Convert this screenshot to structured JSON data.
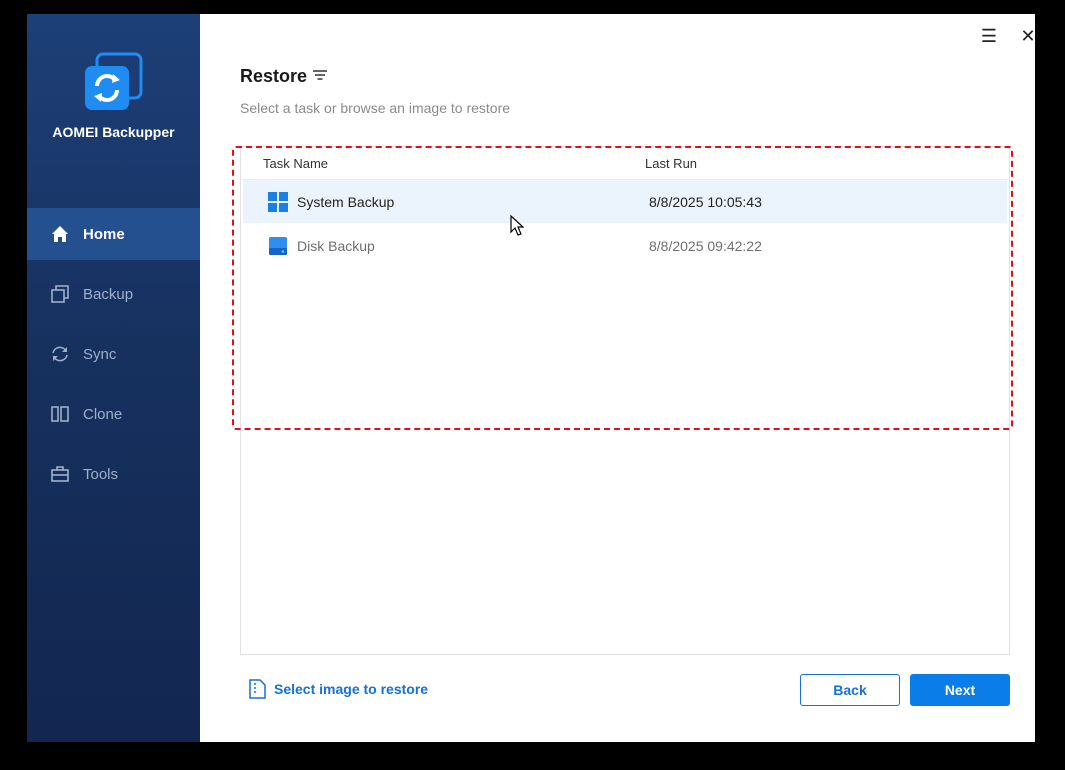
{
  "app": {
    "name": "AOMEI Backupper"
  },
  "window_controls": {
    "menu_icon": "hamburger-icon",
    "close_icon": "close-icon",
    "menu_glyph": "☰",
    "close_glyph": "✕"
  },
  "sidebar": {
    "items": [
      {
        "label": "Home",
        "icon": "home-icon",
        "active": true
      },
      {
        "label": "Backup",
        "icon": "backup-icon",
        "active": false
      },
      {
        "label": "Sync",
        "icon": "sync-icon",
        "active": false
      },
      {
        "label": "Clone",
        "icon": "clone-icon",
        "active": false
      },
      {
        "label": "Tools",
        "icon": "tools-icon",
        "active": false
      }
    ]
  },
  "page": {
    "title": "Restore",
    "subtitle": "Select a task or browse an image to restore"
  },
  "table": {
    "columns": [
      "Task Name",
      "Last Run"
    ],
    "rows": [
      {
        "name": "System Backup",
        "last_run": "8/8/2025 10:05:43",
        "icon": "windows-icon",
        "selected": true
      },
      {
        "name": "Disk Backup",
        "last_run": "8/8/2025 09:42:22",
        "icon": "disk-icon",
        "selected": false
      }
    ]
  },
  "footer": {
    "select_image_label": "Select image to restore",
    "back_label": "Back",
    "next_label": "Next"
  },
  "colors": {
    "accent": "#1670d6",
    "sidebar": "#17315f",
    "highlight": "#e0101a"
  }
}
